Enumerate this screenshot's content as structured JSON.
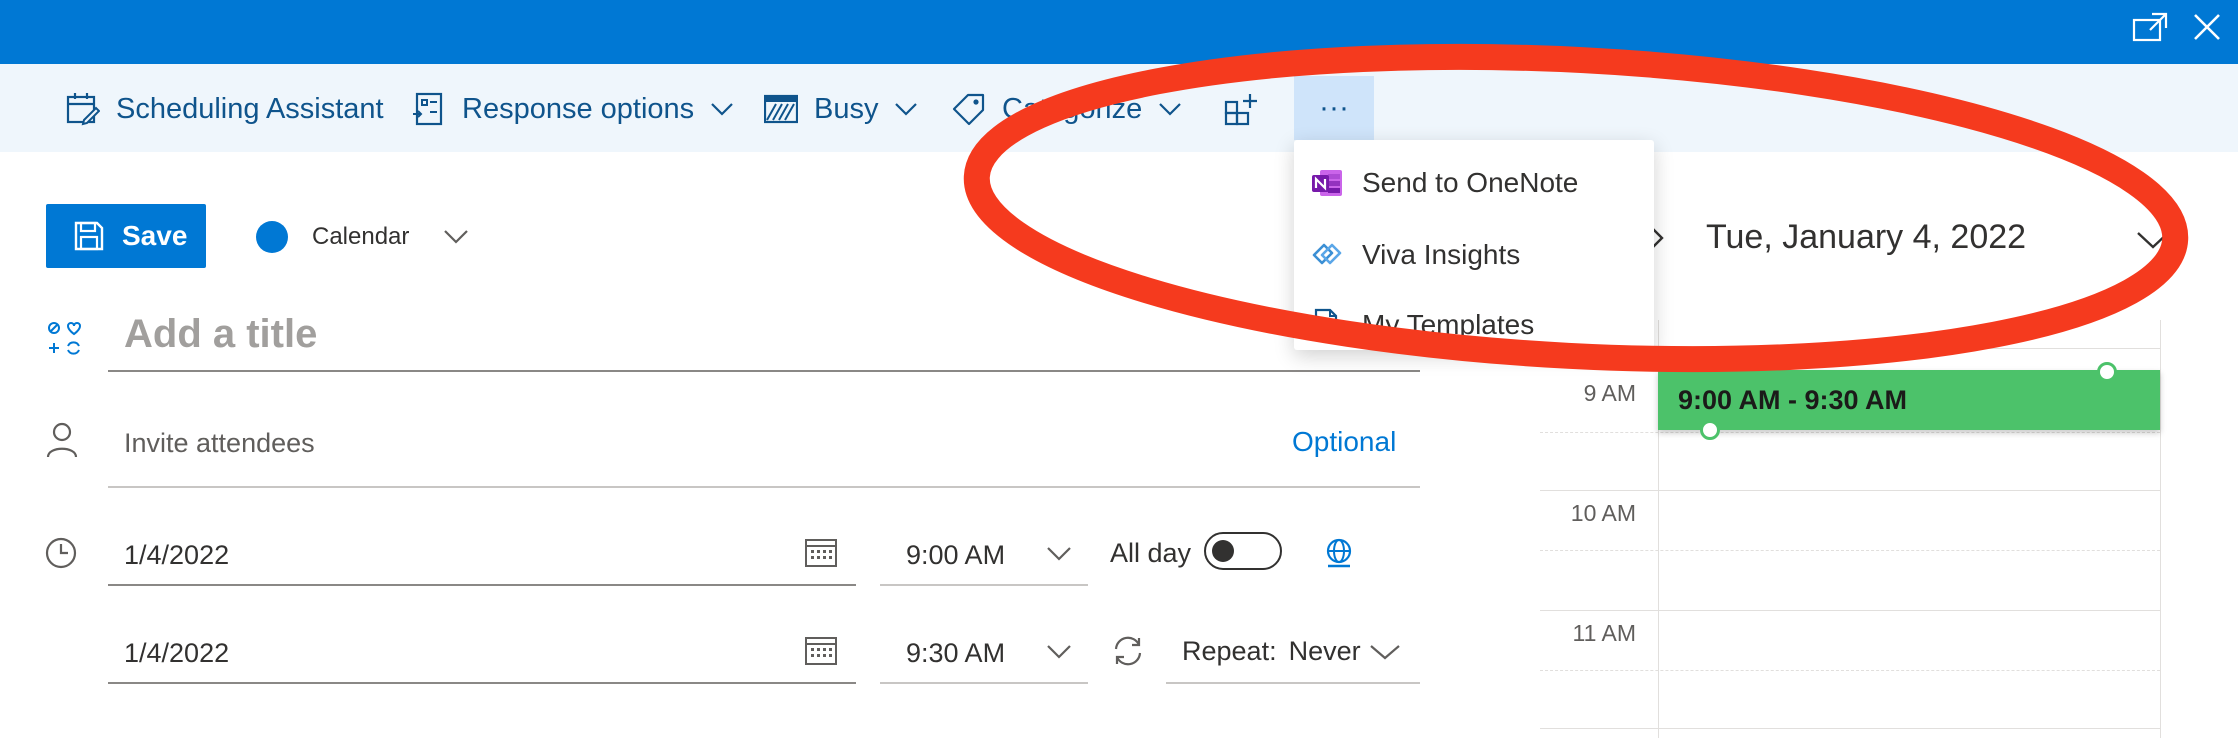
{
  "window": {
    "controls": {
      "popout_icon": "popout-icon",
      "close_icon": "close-icon"
    }
  },
  "toolbar": {
    "scheduling_assistant": "Scheduling Assistant",
    "response_options": "Response options",
    "busy": "Busy",
    "categorize": "Categorize",
    "apps_icon": "apps-add-icon",
    "more": "···"
  },
  "more_menu": {
    "items": [
      {
        "label": "Send to OneNote",
        "icon": "onenote-icon"
      },
      {
        "label": "Viva Insights",
        "icon": "viva-insights-icon"
      },
      {
        "label": "My Templates",
        "icon": "templates-icon"
      }
    ]
  },
  "actions": {
    "save_label": "Save",
    "calendar_label": "Calendar"
  },
  "form": {
    "title_placeholder": "Add a title",
    "attendees_placeholder": "Invite attendees",
    "optional_label": "Optional",
    "start_date": "1/4/2022",
    "start_time": "9:00 AM",
    "all_day_label": "All day",
    "all_day_on": false,
    "end_date": "1/4/2022",
    "end_time": "9:30 AM",
    "repeat_label": "Repeat:",
    "repeat_value": "Never"
  },
  "day_view": {
    "date_label": "Tue, January 4, 2022",
    "hours": [
      "9 AM",
      "10 AM",
      "11 AM"
    ],
    "event_label": "9:00 AM - 9:30 AM",
    "event_color": "#4cc26a"
  },
  "colors": {
    "brand_blue": "#0078d4",
    "toolbar_bg": "#eff6fc",
    "annotation_red": "#f53a1e"
  }
}
